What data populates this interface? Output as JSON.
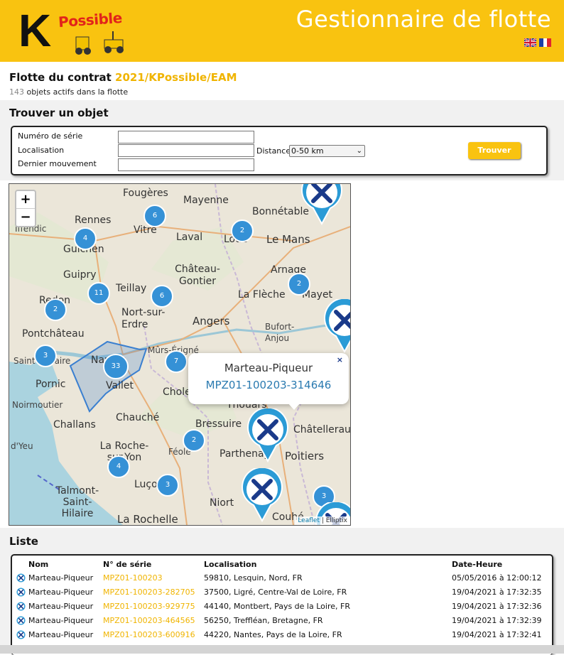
{
  "header": {
    "logo_letter": "K",
    "logo_word": "Possible",
    "app_title": "Gestionnaire de flotte",
    "languages": [
      "English",
      "Français"
    ]
  },
  "contract": {
    "prefix": "Flotte du contrat ",
    "code": "2021/KPossible/EAM",
    "count": "143",
    "count_suffix": " objets actifs dans la flotte"
  },
  "search": {
    "title": "Trouver un objet",
    "serial_label": "Numéro de série",
    "location_label": "Localisation",
    "last_move_label": "Dernier mouvement",
    "distance_label": "Distance",
    "distance_value": "0-50 km",
    "button": "Trouver"
  },
  "map": {
    "zoom_in": "+",
    "zoom_out": "−",
    "places": [
      "Fougères",
      "Mayenne",
      "Rennes",
      "Vitré",
      "Laval",
      "Bonnétable",
      "Le Mans",
      "Iffendic",
      "Loué",
      "Guichen",
      "Château-Gontier",
      "Arnage",
      "Guipry",
      "Teillay",
      "La Flèche",
      "Mayet",
      "Redon",
      "Nort-sur-Erdre",
      "Angers",
      "Bufort-Anjou",
      "Pontchâteau",
      "Saint-Nazaire",
      "Nantes",
      "Mûrs-Érigné",
      "Vallet",
      "Pornic",
      "Cholet",
      "Noirmoutier",
      "Thouars",
      "Bressuire",
      "Châtellerault",
      "Challans",
      "Chauché",
      "Parthenay",
      "Poitiers",
      "d'Yeu",
      "La Roche-sur-Yon",
      "Féole",
      "Luçon",
      "Talmont-Saint-Hilaire",
      "Niort",
      "Couhé",
      "La Rochelle"
    ],
    "clusters": [
      "6",
      "4",
      "2",
      "2",
      "11",
      "6",
      "2",
      "2",
      "3",
      "33",
      "7",
      "2",
      "4",
      "3",
      "3"
    ],
    "popup": {
      "title": "Marteau-Piqueur",
      "link": "MPZ01-100203-314646",
      "close": "×"
    },
    "attribution_link": "Leaflet",
    "attribution_rest": " | Elliptix"
  },
  "list": {
    "title": "Liste",
    "columns": [
      "Nom",
      "N° de série",
      "Localisation",
      "Date-Heure"
    ],
    "rows": [
      {
        "name": "Marteau-Piqueur",
        "serial": "MPZ01-100203",
        "location": "59810, Lesquin, Nord, FR",
        "datetime": "05/05/2016 à 12:00:12"
      },
      {
        "name": "Marteau-Piqueur",
        "serial": "MPZ01-100203-282705",
        "location": "37500, Ligré, Centre-Val de Loire, FR",
        "datetime": "19/04/2021 à 17:32:35"
      },
      {
        "name": "Marteau-Piqueur",
        "serial": "MPZ01-100203-929775",
        "location": "44140, Montbert, Pays de la Loire, FR",
        "datetime": "19/04/2021 à 17:32:36"
      },
      {
        "name": "Marteau-Piqueur",
        "serial": "MPZ01-100203-464565",
        "location": "56250, Treffléan, Bretagne, FR",
        "datetime": "19/04/2021 à 17:32:39"
      },
      {
        "name": "Marteau-Piqueur",
        "serial": "MPZ01-100203-600916",
        "location": "44220, Nantes, Pays de la Loire, FR",
        "datetime": "19/04/2021 à 17:32:41"
      }
    ]
  },
  "colors": {
    "brand_yellow": "#f9c310",
    "serial_yellow": "#f0b400",
    "cluster_blue": "#3591d6",
    "marker_blue": "#2b9bd6"
  }
}
